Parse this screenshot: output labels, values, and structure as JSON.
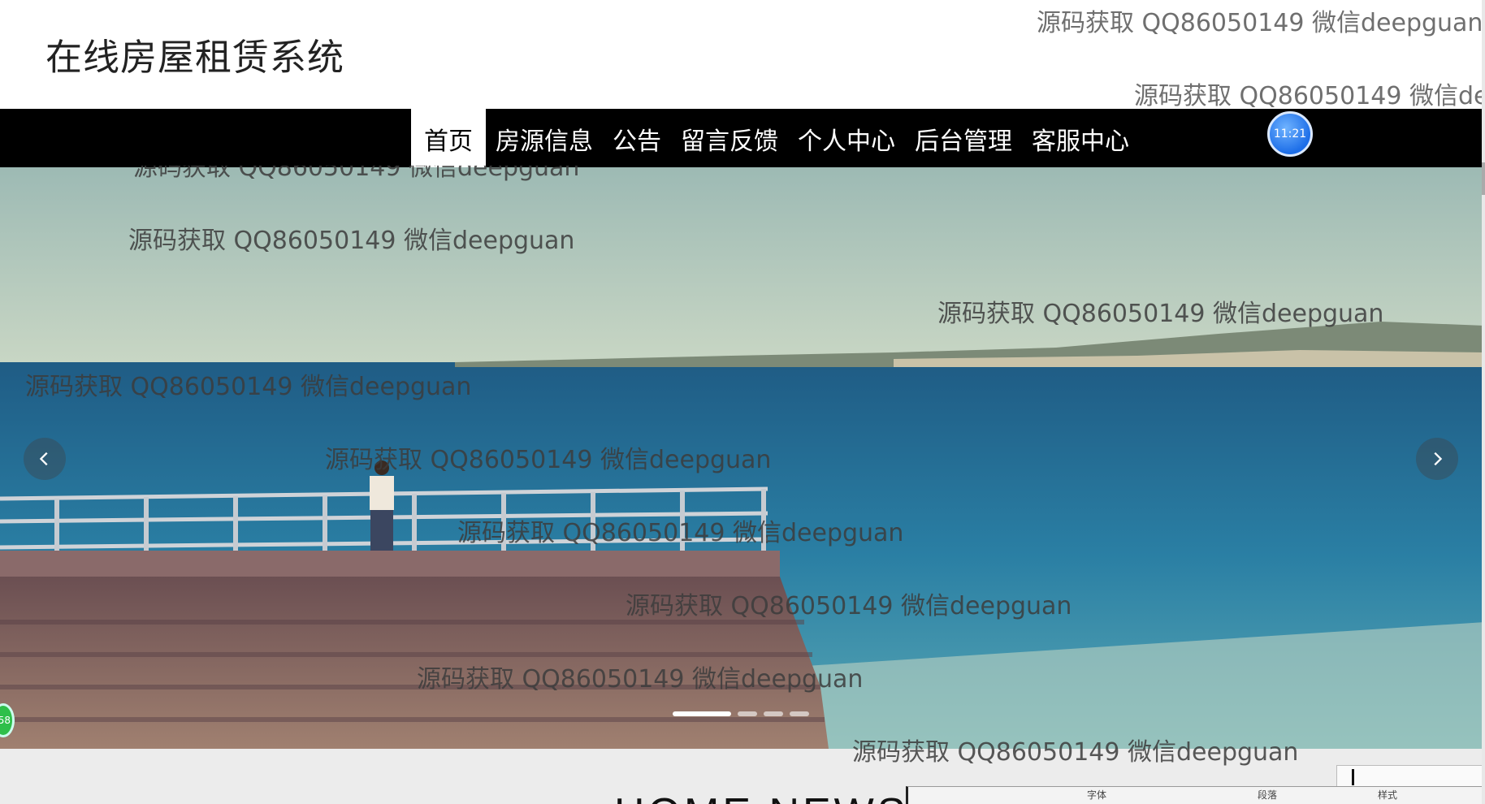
{
  "header": {
    "site_title": "在线房屋租赁系统"
  },
  "nav": {
    "items": [
      {
        "label": "首页",
        "active": true
      },
      {
        "label": "房源信息",
        "active": false
      },
      {
        "label": "公告",
        "active": false
      },
      {
        "label": "留言反馈",
        "active": false
      },
      {
        "label": "个人中心",
        "active": false
      },
      {
        "label": "后台管理",
        "active": false
      },
      {
        "label": "客服中心",
        "active": false
      }
    ],
    "clock_badge": "11:21"
  },
  "banner": {
    "prev_icon": "chevron-left-icon",
    "next_icon": "chevron-right-icon",
    "slide_count": 4,
    "active_slide": 1
  },
  "float_badge": "58",
  "section": {
    "title": "HOME NEWS"
  },
  "toolbar": {
    "font_label": "字体",
    "paragraph_label": "段落",
    "style_label": "样式"
  },
  "watermark": {
    "text": "源码获取 QQ86050149 微信deepguan"
  },
  "colors": {
    "nav_bg": "#000000",
    "header_bg": "#ffffff",
    "page_bg": "#ececec",
    "active_tab_bg": "#ffffff"
  }
}
